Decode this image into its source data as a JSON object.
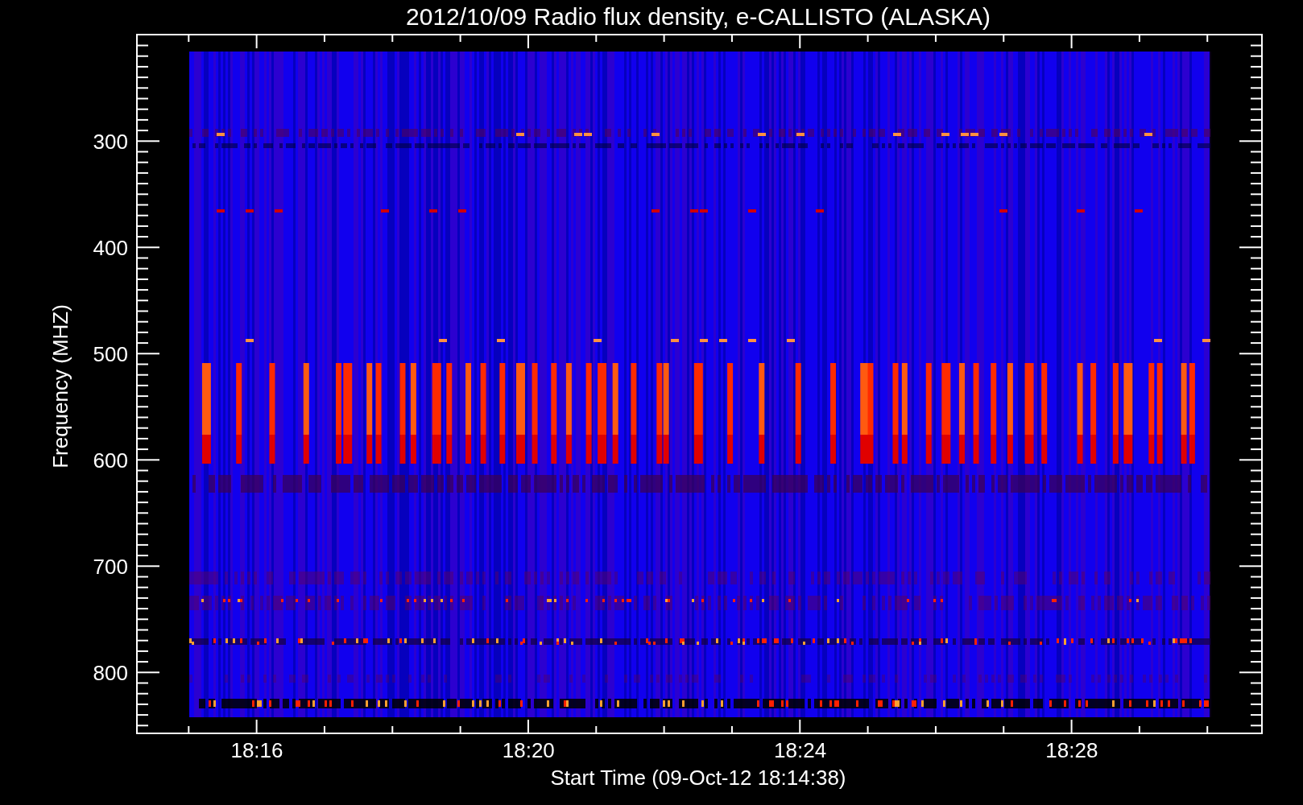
{
  "title": "2012/10/09  Radio flux density, e-CALLISTO (ALASKA)",
  "y_axis": {
    "label": "Frequency (MHZ)",
    "ticks": [
      "300",
      "400",
      "500",
      "600",
      "700",
      "800"
    ]
  },
  "x_axis": {
    "label": "Start Time (09-Oct-12 18:14:38)",
    "ticks": [
      "18:16",
      "18:20",
      "18:24",
      "18:28"
    ]
  }
}
